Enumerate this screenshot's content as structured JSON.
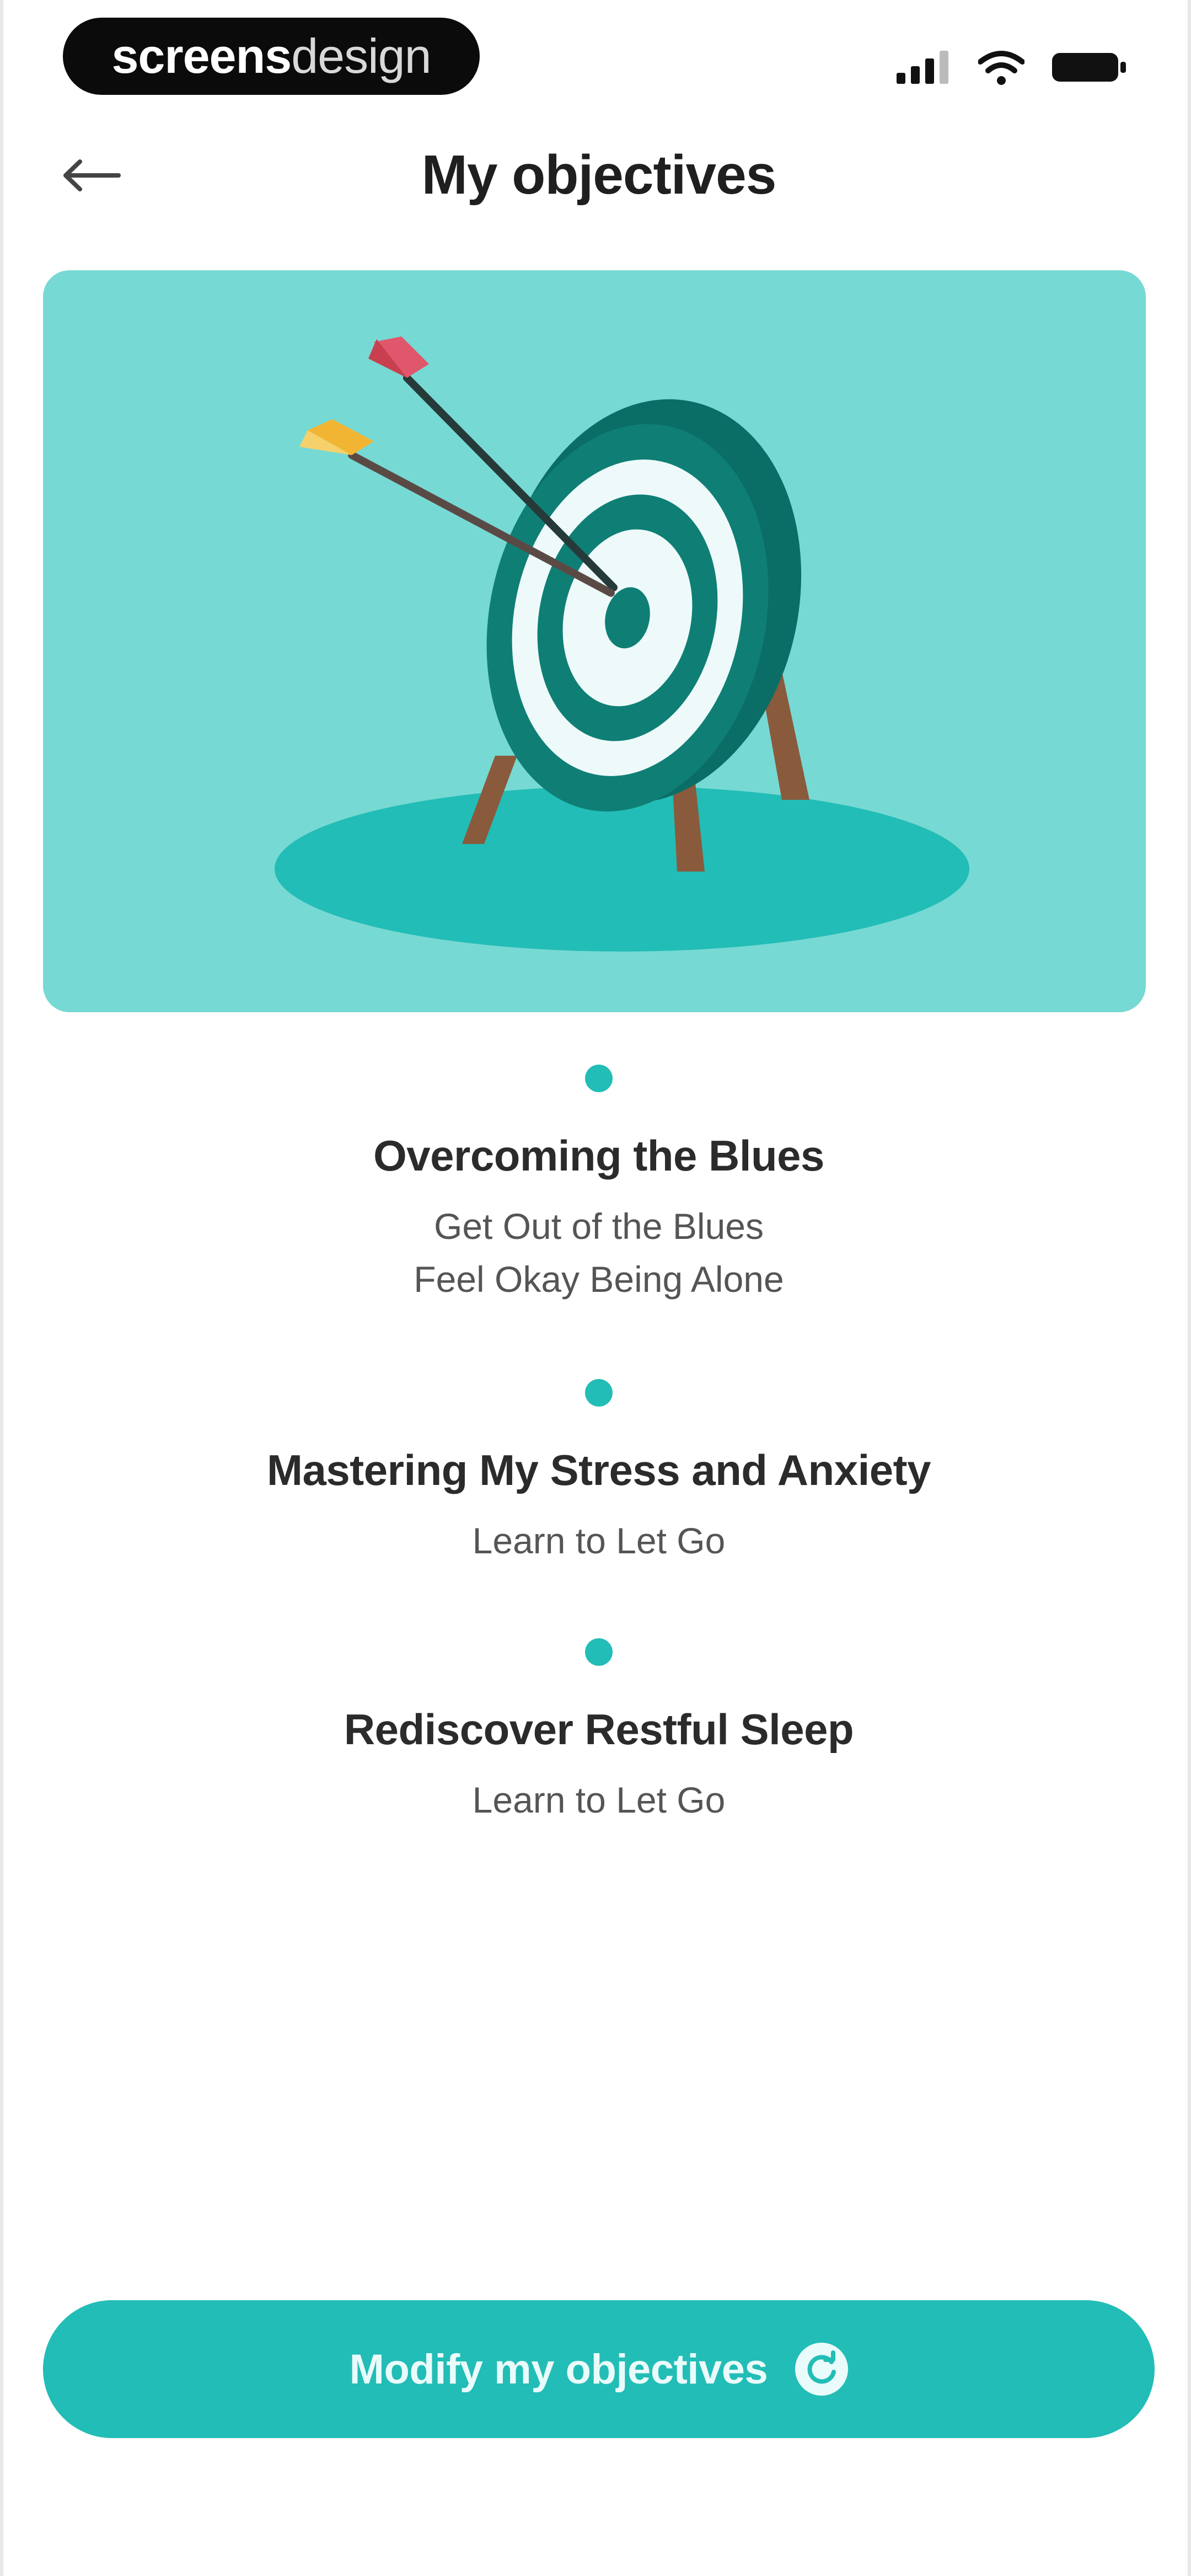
{
  "status_bar": {
    "brand_strong": "screens",
    "brand_light": "design",
    "icons": [
      "signal-icon",
      "wifi-icon",
      "battery-icon"
    ]
  },
  "header": {
    "back_icon": "arrow-left-icon",
    "title": "My objectives"
  },
  "hero": {
    "illustration": "target-with-arrows-illustration",
    "colors": {
      "card": "#77d9d3",
      "ground": "#22bdb6",
      "target_dark": "#0f7f76",
      "target_light": "#eefafa",
      "legs": "#8a5a3c",
      "arrow_red": "#e0566b",
      "arrow_yellow": "#f2b533"
    }
  },
  "objectives": [
    {
      "title": "Overcoming the Blues",
      "items": [
        "Get Out of the Blues",
        "Feel Okay Being Alone"
      ]
    },
    {
      "title": "Mastering My Stress and Anxiety",
      "items": [
        "Learn to Let Go"
      ]
    },
    {
      "title": "Rediscover Restful Sleep",
      "items": [
        "Learn to Let Go"
      ]
    }
  ],
  "footer": {
    "modify_label": "Modify my objectives",
    "modify_icon": "refresh-icon",
    "accent_color": "#22bdb6"
  }
}
